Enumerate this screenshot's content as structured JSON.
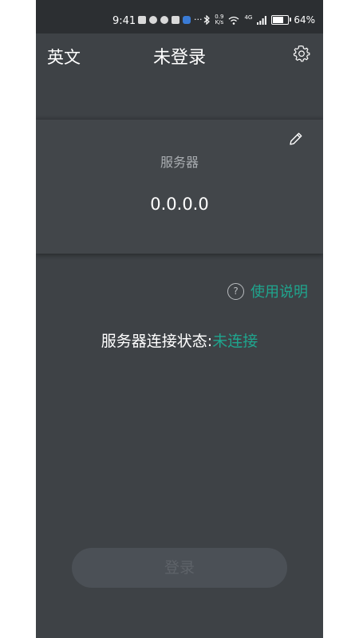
{
  "status_bar": {
    "time": "9:41",
    "more": "···",
    "net_speed_value": "0.9",
    "net_speed_unit": "K/s",
    "network": "4G",
    "battery": "64%",
    "battery_level": 0.64
  },
  "app_bar": {
    "language_label": "英文",
    "title": "未登录"
  },
  "server_card": {
    "label": "服务器",
    "address": "0.0.0.0"
  },
  "help": {
    "icon_text": "?",
    "label": "使用说明"
  },
  "connection": {
    "label": "服务器连接状态:",
    "value": "未连接"
  },
  "login": {
    "label": "登录"
  },
  "colors": {
    "background": "#3e4246",
    "card": "#42464a",
    "accent": "#1fa58e",
    "login_button": "#4b5056"
  }
}
